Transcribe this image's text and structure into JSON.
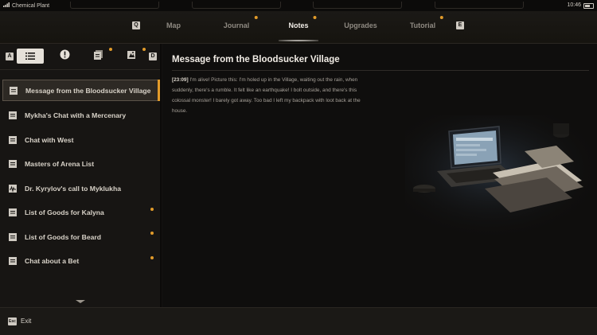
{
  "status": {
    "location": "Chemical Plant",
    "time": "10:46"
  },
  "nav": {
    "left_key": "Q",
    "right_key": "E",
    "tabs": [
      {
        "label": "Map",
        "dot": false,
        "active": false
      },
      {
        "label": "Journal",
        "dot": true,
        "active": false
      },
      {
        "label": "Notes",
        "dot": true,
        "active": true
      },
      {
        "label": "Upgrades",
        "dot": false,
        "active": false
      },
      {
        "label": "Tutorial",
        "dot": true,
        "active": false
      }
    ]
  },
  "filters": {
    "left_key": "A",
    "right_key": "D",
    "buttons": [
      {
        "icon": "list-icon",
        "active": true,
        "dot": false
      },
      {
        "icon": "exclamation-icon",
        "active": false,
        "dot": false
      },
      {
        "icon": "note-stack-icon",
        "active": false,
        "dot": true
      },
      {
        "icon": "map-note-icon",
        "active": false,
        "dot": true
      }
    ]
  },
  "notes": [
    {
      "label": "Message from the Bloodsucker Village",
      "icon": "note-icon",
      "active": true,
      "dot": false
    },
    {
      "label": "Mykha's Chat with a Mercenary",
      "icon": "note-icon",
      "active": false,
      "dot": false
    },
    {
      "label": "Chat with West",
      "icon": "note-icon",
      "active": false,
      "dot": false
    },
    {
      "label": "Masters of Arena List",
      "icon": "note-icon",
      "active": false,
      "dot": false
    },
    {
      "label": "Dr. Kyrylov's call to Myklukha",
      "icon": "audio-note-icon",
      "active": false,
      "dot": false
    },
    {
      "label": "List of Goods for Kalyna",
      "icon": "note-icon",
      "active": false,
      "dot": true
    },
    {
      "label": "List of Goods for Beard",
      "icon": "note-icon",
      "active": false,
      "dot": true
    },
    {
      "label": "Chat about a Bet",
      "icon": "note-icon",
      "active": false,
      "dot": true
    }
  ],
  "content": {
    "title": "Message from the Bloodsucker Village",
    "timestamp": "[23:09]",
    "body": " I'm alive! Picture this: I'm holed up in the Village, waiting out the rain, when suddenly, there's a rumble. It felt like an earthquake! I bolt outside, and there's this colossal monster! I barely got away. Too bad I left my backpack with loot back at the house."
  },
  "footer": {
    "exit_key": "Esc",
    "exit_label": "Exit"
  },
  "colors": {
    "accent": "#e29b2a",
    "background": "#141210",
    "text": "#d9d4cc"
  }
}
